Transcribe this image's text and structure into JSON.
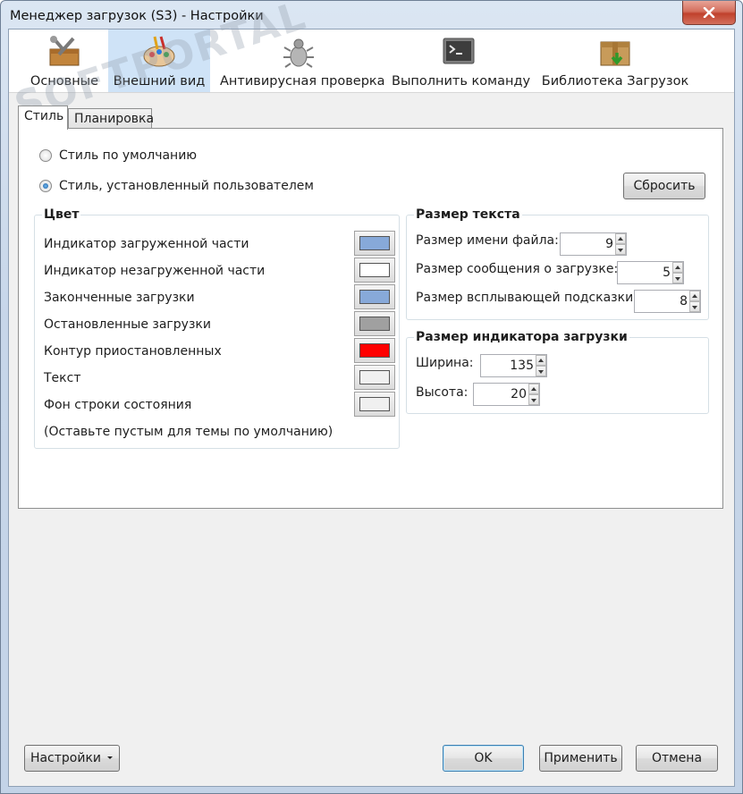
{
  "window": {
    "title": "Менеджер загрузок (S3) - Настройки"
  },
  "watermark": "SOFTPORTAL",
  "toolbar": {
    "items": [
      {
        "label": "Основные",
        "icon": "toolbox-icon"
      },
      {
        "label": "Внешний вид",
        "icon": "palette-icon"
      },
      {
        "label": "Антивирусная проверка",
        "icon": "bug-icon"
      },
      {
        "label": "Выполнить команду",
        "icon": "terminal-icon"
      },
      {
        "label": "Библиотека Загрузок",
        "icon": "box-download-icon"
      }
    ]
  },
  "tabs": [
    "Стиль",
    "Планировка"
  ],
  "style": {
    "default_label": "Стиль по умолчанию",
    "custom_label": "Стиль, установленный пользователем",
    "reset_label": "Сбросить"
  },
  "color_group": {
    "title": "Цвет",
    "items": [
      {
        "label": "Индикатор загруженной части",
        "color": "#87a9d9"
      },
      {
        "label": "Индикатор незагруженной части",
        "color": "#ffffff"
      },
      {
        "label": "Законченные загрузки",
        "color": "#87a9d9"
      },
      {
        "label": "Остановленные загрузки",
        "color": "#a0a0a0"
      },
      {
        "label": "Контур приостановленных",
        "color": "#ff0000"
      },
      {
        "label": "Текст",
        "color": "#f0f0f0"
      },
      {
        "label": "Фон строки состояния",
        "color": "#f0f0f0"
      }
    ],
    "hint": "(Оставьте пустым для темы по умолчанию)"
  },
  "text_size_group": {
    "title": "Размер текста",
    "filename_label": "Размер имени файла:",
    "filename_value": "9",
    "message_label": "Размер сообщения о загрузке:",
    "message_value": "5",
    "tooltip_label": "Размер всплывающей подсказки:",
    "tooltip_value": "8"
  },
  "indicator_group": {
    "title": "Размер индикатора загрузки",
    "width_label": "Ширина:",
    "width_value": "135",
    "height_label": "Высота:",
    "height_value": "20"
  },
  "footer": {
    "settings_label": "Настройки",
    "ok_label": "OK",
    "apply_label": "Применить",
    "cancel_label": "Отмена"
  }
}
